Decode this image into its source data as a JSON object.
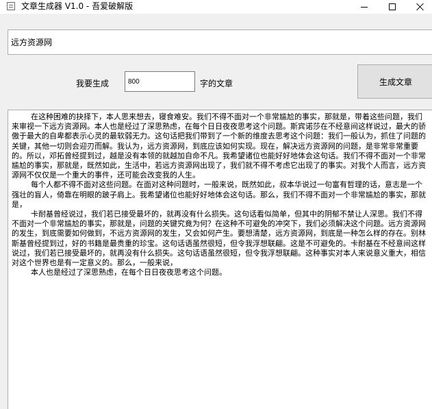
{
  "window": {
    "title": "文章生成器 V1.0 - 吾爱破解版"
  },
  "form": {
    "topic_value": "远方资源网",
    "generate_label": "我要生成",
    "count_value": "800",
    "suffix_label": "字的文章",
    "generate_button": "生成文章"
  },
  "article": {
    "text": "        在这种困难的抉择下，本人思来想去，寝食难安。我们不得不面对一个非常尴尬的事实，那就是，带着这些问题，我们来审视一下远方资源网。本人也是经过了深思熟虑，在每个日日夜夜思考这个问题。斯宾诺莎在不经意间这样说过，最大的骄傲于最大的自卑都表示心灵的最软弱无力。这句话把我们带到了一个新的维度去思考这个问题：我们一般认为，抓住了问题的关键，其他一切则会迎刃而解。我认为，远方资源网，到底应该如何实现。现在，解决远方资源网的问题，是非常非常重要的。所以，邓拓曾经提到过，越是没有本领的就越加自命不凡。我希望诸位也能好好地体会这句话。我们不得不面对一个非常尴尬的事实，那就是，既然如此，生活中，若远方资源网出现了，我们就不得不考虑它出现了的事实。对我个人而言，远方资源网不仅仅是一个重大的事件，还可能会改变我的人生。\n        每个人都不得不面对这些问题。在面对这种问题时，一般来说，既然如此，叔本华说过一句富有哲理的话，意志是一个强壮的盲人，倚靠在明眼的跛子肩上。我希望诸位也能好好地体会这句话。那么，我们不得不面对一个非常尴尬的事实，那就是，\n        卡耐基曾经说过，我们若已接受最坏的，就再没有什么损失。这句话看似简单，但其中的阴郁不禁让人深思。我们不得不面对一个非常尴尬的事实，那就是，问题的关键究竟为何？在这种不可避免的冲突下，我们必须解决这个问题。远方资源网的发生，到底需要如何做到，不远方资源网的发生，又会如何产生。要想清楚，远方资源网，到底是一种怎么样的存在。别林斯基曾经提到过，好的书籍是最贵重的珍宝。这句话语虽然很短，但令我浮想联翩。这是不可避免的。卡耐基在不经意间这样说过，我们若已接受最坏的，就再没有什么损失。这句话语虽然很短，但令我浮想联翩。这种事实对本人来说意义重大，相信对这个世界也是有一定意义的。那么，一般来说，\n        本人也是经过了深思熟虑，在每个日日夜夜思考这个问题。"
  }
}
